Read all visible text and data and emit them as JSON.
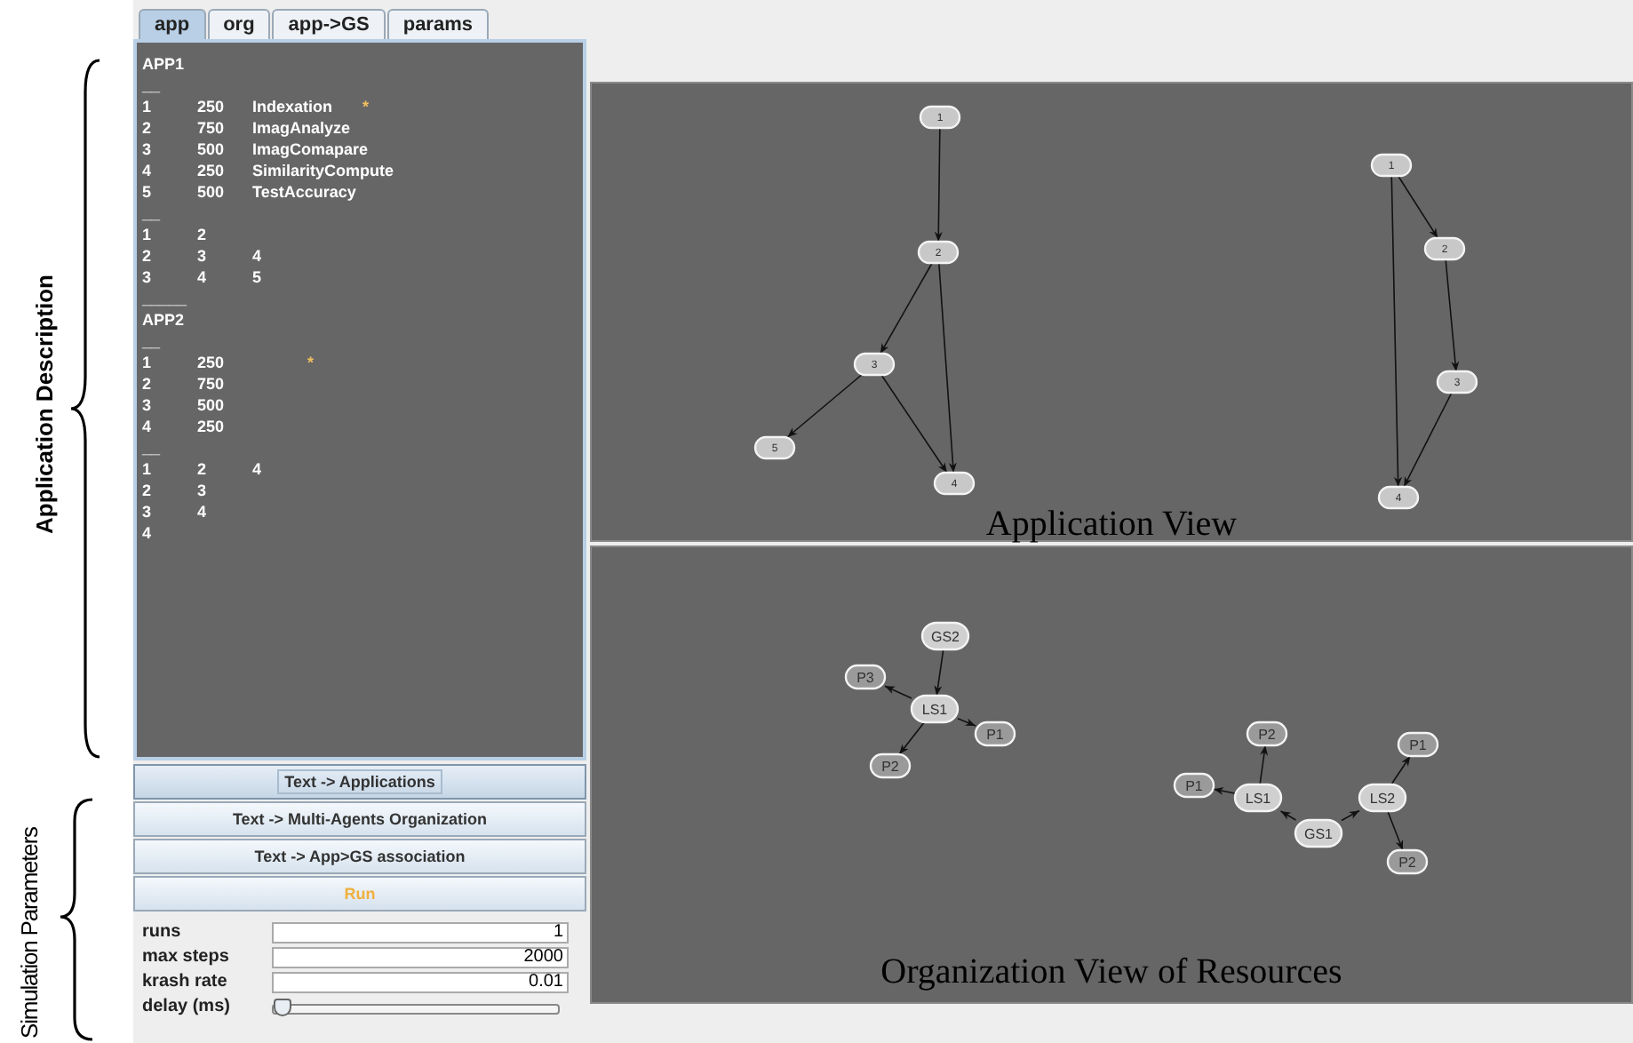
{
  "annotations": [
    {
      "label": "Application Description"
    },
    {
      "label": "Simulation Parameters"
    }
  ],
  "tabs": [
    {
      "label": "app",
      "selected": true
    },
    {
      "label": "org",
      "selected": false
    },
    {
      "label": "app->GS",
      "selected": false
    },
    {
      "label": "params",
      "selected": false
    }
  ],
  "app_text": {
    "lines": [
      {
        "text": "APP1"
      },
      {
        "text": "__"
      },
      {
        "text": "1\t250\tIndexation\t",
        "mark": "*"
      },
      {
        "text": "2\t750\tImagAnalyze"
      },
      {
        "text": "3\t500\tImagComapare"
      },
      {
        "text": "4\t250\tSimilarityCompute"
      },
      {
        "text": "5\t500\tTestAccuracy"
      },
      {
        "text": "__"
      },
      {
        "text": "1\t2"
      },
      {
        "text": "2\t3\t4"
      },
      {
        "text": "3\t4\t5"
      },
      {
        "text": "_____"
      },
      {
        "text": "APP2"
      },
      {
        "text": "__"
      },
      {
        "text": "1\t250\t\t",
        "mark": "*"
      },
      {
        "text": "2\t750"
      },
      {
        "text": "3\t500"
      },
      {
        "text": "4\t250"
      },
      {
        "text": "__"
      },
      {
        "text": "1\t2\t4"
      },
      {
        "text": "2\t3"
      },
      {
        "text": "3\t4"
      },
      {
        "text": "4"
      }
    ]
  },
  "buttons": [
    {
      "label": "Text -> Applications",
      "kind": "convert",
      "focused": true
    },
    {
      "label": "Text -> Multi-Agents Organization",
      "kind": "convert",
      "focused": false
    },
    {
      "label": "Text -> App>GS association",
      "kind": "convert",
      "focused": false
    },
    {
      "label": "Run",
      "kind": "run",
      "focused": false
    }
  ],
  "params": [
    {
      "label": "runs",
      "kind": "field",
      "value": "1"
    },
    {
      "label": "max steps",
      "kind": "field",
      "value": "2000"
    },
    {
      "label": "krash rate",
      "kind": "field",
      "value": "0.01"
    },
    {
      "label": "delay (ms)",
      "kind": "slider",
      "level": 0
    }
  ],
  "application_view": {
    "caption": "Application View",
    "graphs": [
      {
        "nodes": [
          {
            "label": "1",
            "kind": "task"
          },
          {
            "label": "2",
            "kind": "task"
          },
          {
            "label": "3",
            "kind": "task"
          },
          {
            "label": "4",
            "kind": "task"
          },
          {
            "label": "5",
            "kind": "task"
          }
        ]
      },
      {
        "nodes": [
          {
            "label": "1",
            "kind": "task"
          },
          {
            "label": "2",
            "kind": "task"
          },
          {
            "label": "3",
            "kind": "task"
          },
          {
            "label": "4",
            "kind": "task"
          }
        ]
      }
    ]
  },
  "organization_view": {
    "caption": "Organization View of Resources",
    "graphs": [
      {
        "nodes": [
          {
            "label": "GS2",
            "kind": "server"
          },
          {
            "label": "LS1",
            "kind": "server"
          },
          {
            "label": "P3",
            "kind": "processor"
          },
          {
            "label": "P1",
            "kind": "processor"
          },
          {
            "label": "P2",
            "kind": "processor"
          }
        ]
      },
      {
        "nodes": [
          {
            "label": "GS1",
            "kind": "server"
          },
          {
            "label": "LS1",
            "kind": "server"
          },
          {
            "label": "LS2",
            "kind": "server"
          },
          {
            "label": "P1",
            "kind": "processor"
          },
          {
            "label": "P2",
            "kind": "processor"
          },
          {
            "label": "P1",
            "kind": "processor"
          },
          {
            "label": "P2",
            "kind": "processor"
          }
        ]
      }
    ]
  }
}
